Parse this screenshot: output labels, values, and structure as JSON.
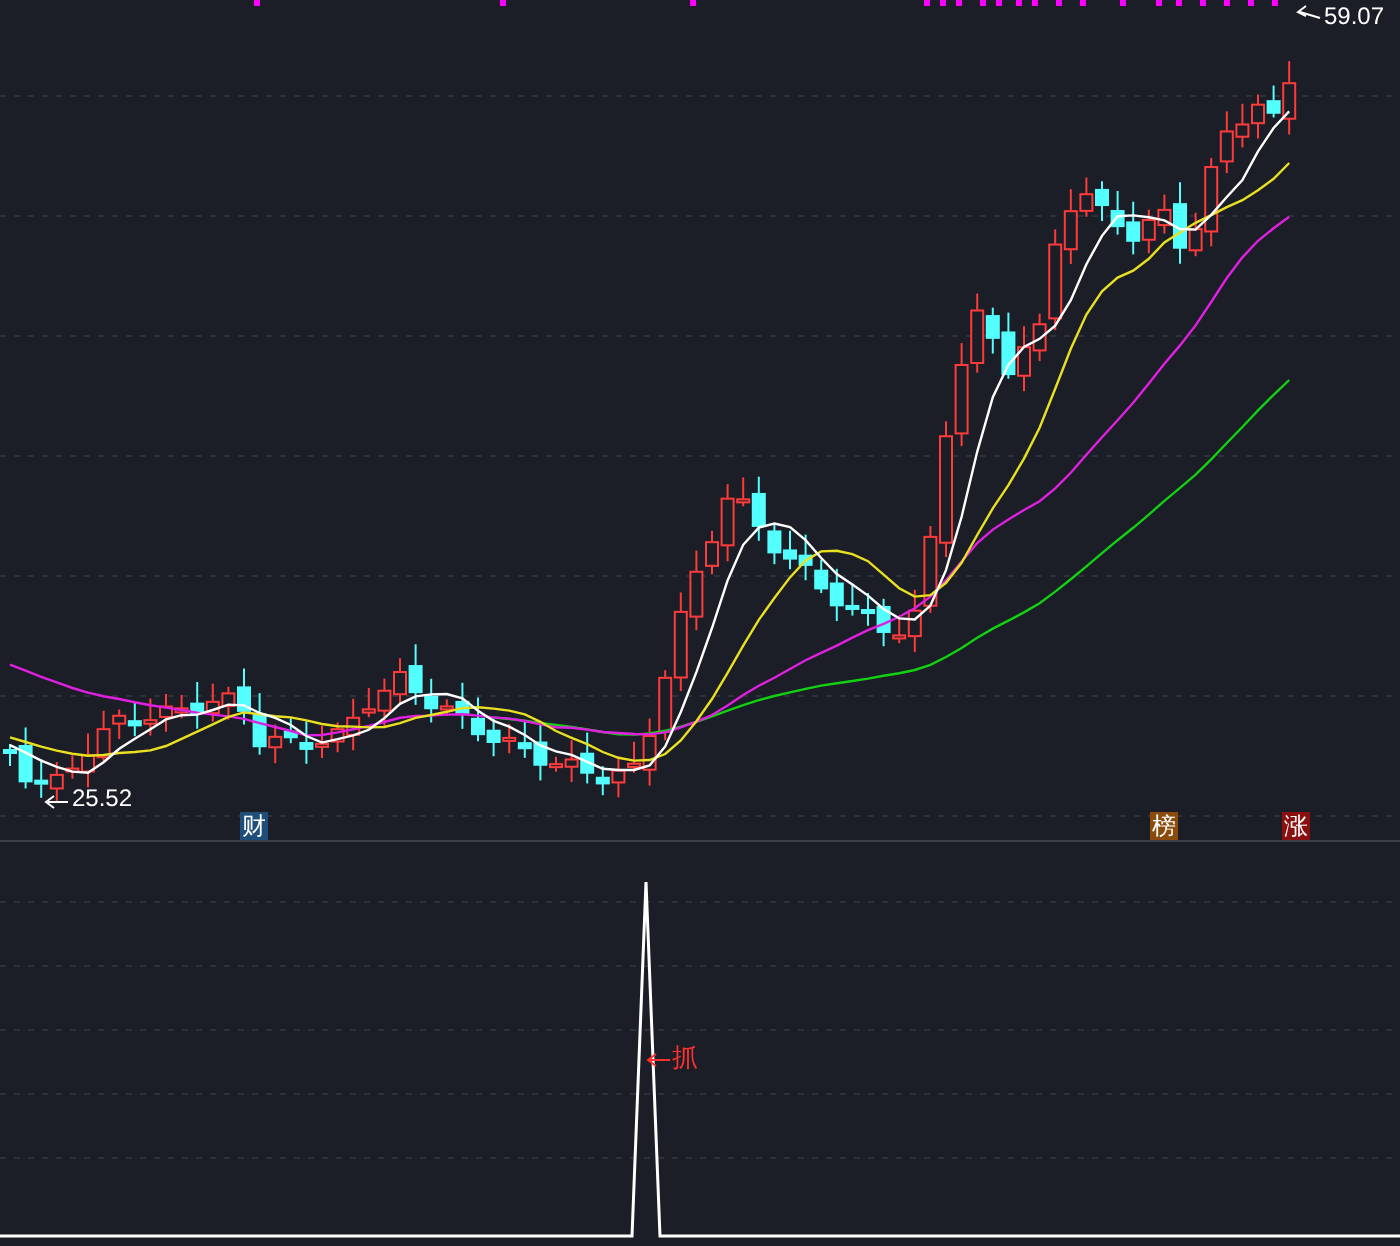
{
  "price_chart": {
    "high_label": "59.07",
    "low_label": "25.52",
    "markers": [
      {
        "text": "财",
        "color": "#1f4e7a"
      },
      {
        "text": "榜",
        "color": "#8a4b0c"
      },
      {
        "text": "涨",
        "color": "#8a0f0f"
      }
    ]
  },
  "indicator_chart": {
    "signal_label": "抓"
  }
}
